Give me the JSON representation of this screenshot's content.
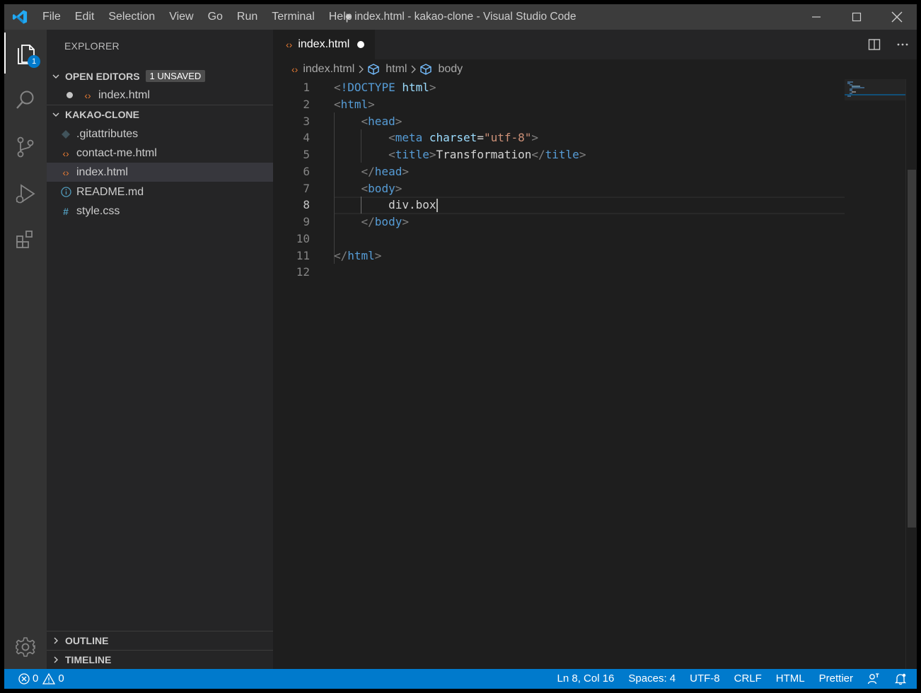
{
  "titlebar": {
    "menu": [
      "File",
      "Edit",
      "Selection",
      "View",
      "Go",
      "Run",
      "Terminal",
      "Help"
    ],
    "title": "● index.html - kakao-clone - Visual Studio Code"
  },
  "activity": {
    "explorer_badge": "1"
  },
  "sidebar": {
    "title": "EXPLORER",
    "open_editors": {
      "label": "OPEN EDITORS",
      "badge": "1 UNSAVED",
      "files": [
        "index.html"
      ]
    },
    "project": {
      "label": "KAKAO-CLONE",
      "files": [
        ".gitattributes",
        "contact-me.html",
        "index.html",
        "README.md",
        "style.css"
      ]
    },
    "outline_label": "OUTLINE",
    "timeline_label": "TIMELINE"
  },
  "tabs": [
    {
      "label": "index.html",
      "dirty": true
    }
  ],
  "breadcrumb": [
    "index.html",
    "html",
    "body"
  ],
  "editor": {
    "line_numbers": [
      "1",
      "2",
      "3",
      "4",
      "5",
      "6",
      "7",
      "8",
      "9",
      "10",
      "11",
      "12"
    ],
    "tokens": {
      "doctype_kw": "!DOCTYPE",
      "html": "html",
      "head": "head",
      "meta": "meta",
      "charset_attr": "charset",
      "charset_val": "\"utf-8\"",
      "title": "title",
      "title_text": "Transformation",
      "body": "body",
      "line8_text": "div.box"
    }
  },
  "statusbar": {
    "errors": "0",
    "warnings": "0",
    "position": "Ln 8, Col 16",
    "spaces": "Spaces: 4",
    "encoding": "UTF-8",
    "eol": "CRLF",
    "language": "HTML",
    "formatter": "Prettier"
  },
  "colors": {
    "accent": "#007acc",
    "tag": "#569cd6",
    "attr": "#9cdcfe",
    "string": "#ce9178",
    "html_file_icon": "#e37933"
  }
}
